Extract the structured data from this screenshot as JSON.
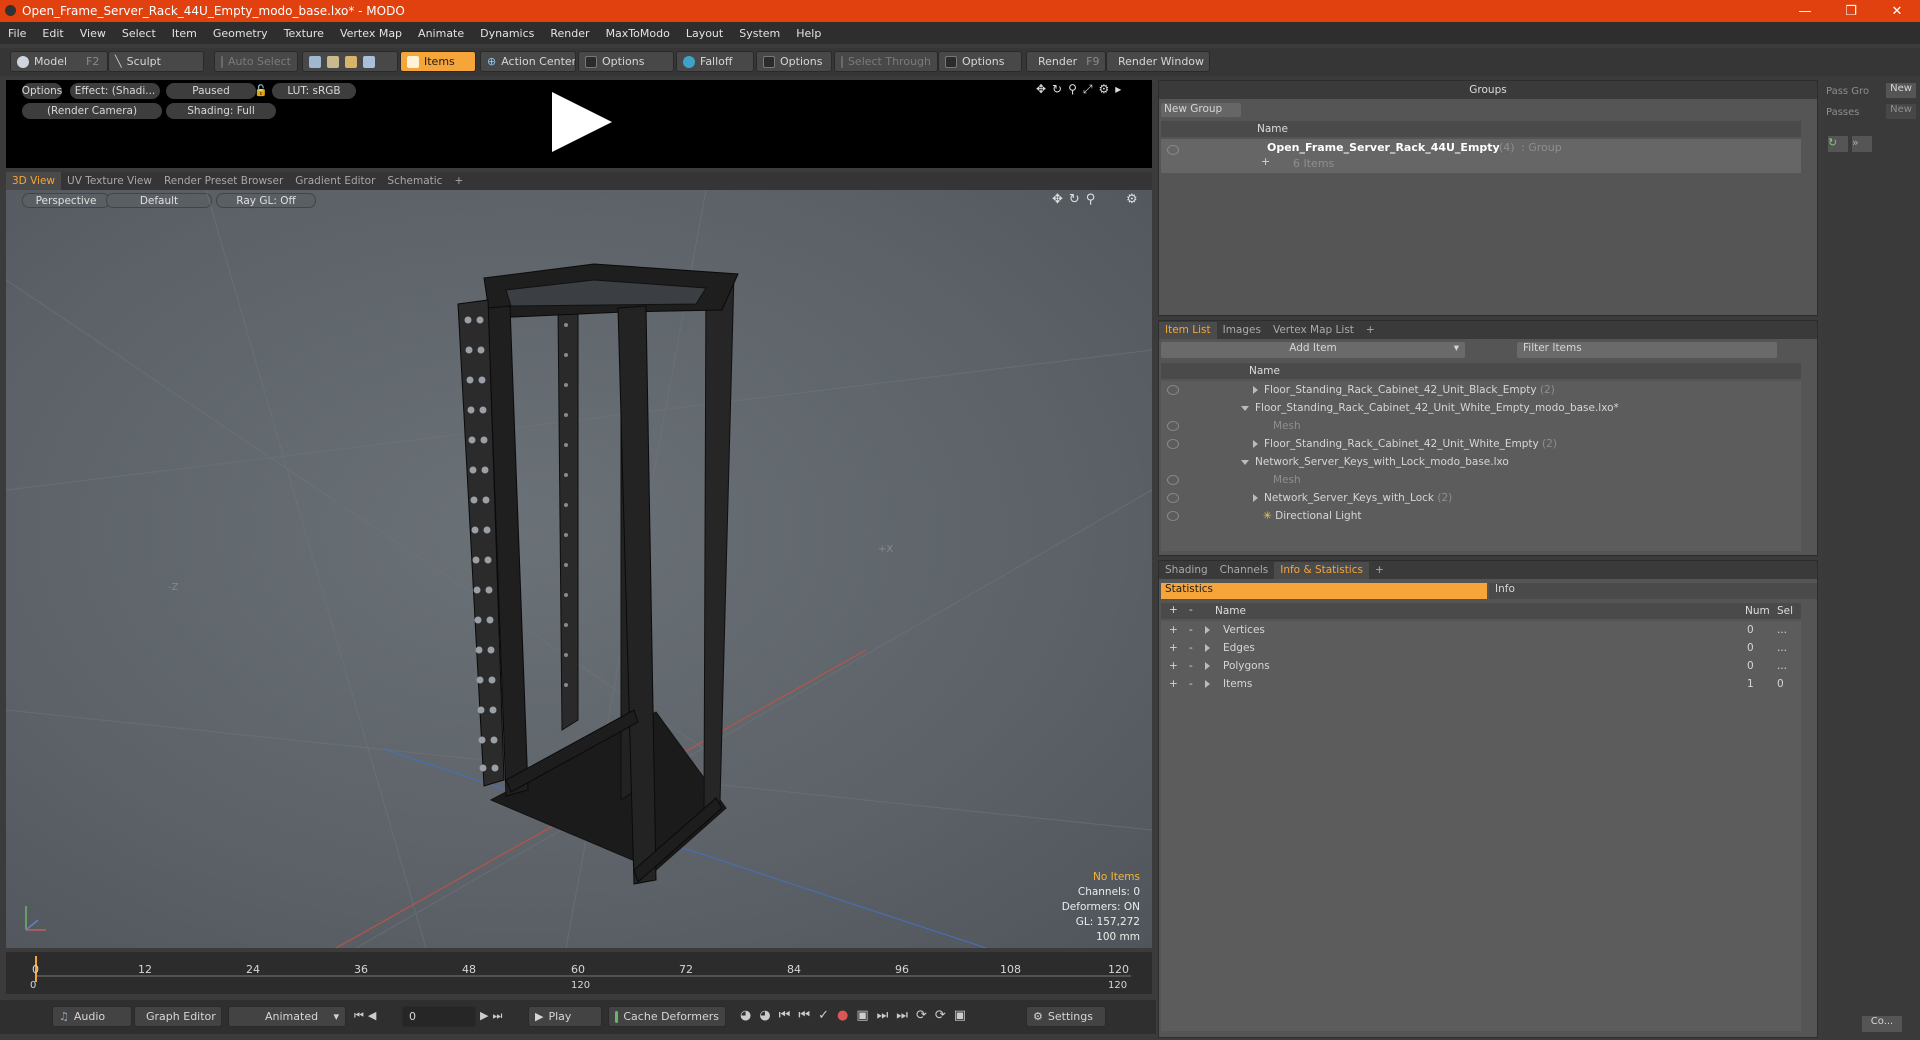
{
  "window": {
    "title": "Open_Frame_Server_Rack_44U_Empty_modo_base.lxo* - MODO"
  },
  "menu": [
    "File",
    "Edit",
    "View",
    "Select",
    "Item",
    "Geometry",
    "Texture",
    "Vertex Map",
    "Animate",
    "Dynamics",
    "Render",
    "MaxToModo",
    "Layout",
    "System",
    "Help"
  ],
  "toolbar": {
    "model": "Model",
    "model_key": "F2",
    "sculpt": "Sculpt",
    "auto_select": "Auto Select",
    "items": "Items",
    "action_center": "Action Center",
    "options1": "Options",
    "falloff": "Falloff",
    "options2": "Options",
    "select_through": "Select Through",
    "options3": "Options",
    "render": "Render",
    "render_key": "F9",
    "render_window": "Render Window"
  },
  "render_strip": {
    "options": "Options",
    "effect": "Effect: (Shadi...",
    "paused": "Paused",
    "lut": "LUT: sRGB",
    "camera": "(Render Camera)",
    "shading": "Shading: Full"
  },
  "viewport_tabs": [
    "3D View",
    "UV Texture View",
    "Render Preset Browser",
    "Gradient Editor",
    "Schematic",
    "+"
  ],
  "viewport": {
    "perspective": "Perspective",
    "default": "Default",
    "raygl": "Ray GL: Off",
    "hud": {
      "no_items": "No Items",
      "channels": "Channels: 0",
      "deformers": "Deformers: ON",
      "gl": "GL: 157,272",
      "scale": "100 mm"
    }
  },
  "timeline": {
    "ticks": [
      "0",
      "12",
      "24",
      "36",
      "48",
      "60",
      "72",
      "84",
      "96",
      "108",
      "120"
    ],
    "sub": [
      "0",
      "120",
      "120"
    ]
  },
  "bottom": {
    "audio": "Audio",
    "graph_editor": "Graph Editor",
    "animated": "Animated",
    "frame": "0",
    "play": "Play",
    "cache": "Cache Deformers",
    "settings": "Settings"
  },
  "groups": {
    "title": "Groups",
    "new_group": "New Group",
    "col_name": "Name",
    "item_name": "Open_Frame_Server_Rack_44U_Empty",
    "item_count": "(4)",
    "item_type": ": Group",
    "item_sub": "6 Items"
  },
  "right_strip": {
    "pass_group": "Pass Gro",
    "new1": "New",
    "passes": "Passes",
    "new2": "New",
    "bottom_btn": "Co..."
  },
  "item_list": {
    "tabs": [
      "Item List",
      "Images",
      "Vertex Map List",
      "+"
    ],
    "add_item": "Add Item",
    "filter": "Filter Items",
    "col_name": "Name",
    "rows": [
      {
        "label": "Floor_Standing_Rack_Cabinet_42_Unit_Black_Empty",
        "count": "(2)"
      },
      {
        "label": "Floor_Standing_Rack_Cabinet_42_Unit_White_Empty_modo_base.lxo*",
        "count": ""
      },
      {
        "label": "Mesh",
        "count": ""
      },
      {
        "label": "Floor_Standing_Rack_Cabinet_42_Unit_White_Empty",
        "count": "(2)"
      },
      {
        "label": "Network_Server_Keys_with_Lock_modo_base.lxo",
        "count": ""
      },
      {
        "label": "Mesh",
        "count": ""
      },
      {
        "label": "Network_Server_Keys_with_Lock",
        "count": "(2)"
      },
      {
        "label": "Directional Light",
        "count": ""
      }
    ]
  },
  "stats": {
    "tabs": [
      "Shading",
      "Channels",
      "Info & Statistics",
      "+"
    ],
    "statistics": "Statistics",
    "info": "Info",
    "cols": {
      "plus": "+",
      "minus": "-",
      "name": "Name",
      "num": "Num",
      "sel": "Sel"
    },
    "rows": [
      {
        "name": "Vertices",
        "num": "0",
        "sel": "..."
      },
      {
        "name": "Edges",
        "num": "0",
        "sel": "..."
      },
      {
        "name": "Polygons",
        "num": "0",
        "sel": "..."
      },
      {
        "name": "Items",
        "num": "1",
        "sel": "0"
      }
    ]
  }
}
